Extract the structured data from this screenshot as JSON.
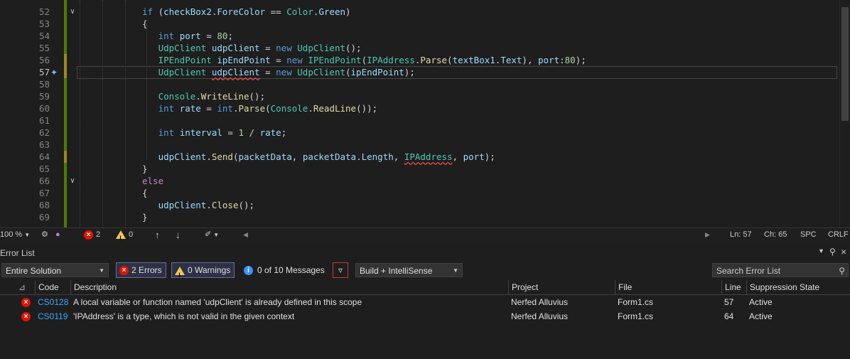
{
  "editor": {
    "lines": [
      {
        "num": "52",
        "tokens": [
          [
            "kw",
            "if"
          ],
          [
            "pl",
            " ("
          ],
          [
            "id",
            "checkBox2"
          ],
          [
            "pl",
            "."
          ],
          [
            "id",
            "ForeColor"
          ],
          [
            "pl",
            " == "
          ],
          [
            "ty",
            "Color"
          ],
          [
            "pl",
            "."
          ],
          [
            "id",
            "Green"
          ],
          [
            "pl",
            ")"
          ]
        ]
      },
      {
        "num": "53",
        "tokens": [
          [
            "pl",
            "{"
          ]
        ]
      },
      {
        "num": "54",
        "tokens": [
          [
            "pl",
            "   "
          ],
          [
            "kw",
            "int"
          ],
          [
            "pl",
            " "
          ],
          [
            "id",
            "port"
          ],
          [
            "pl",
            " = "
          ],
          [
            "num",
            "80"
          ],
          [
            "pl",
            ";"
          ]
        ]
      },
      {
        "num": "55",
        "tokens": [
          [
            "pl",
            "   "
          ],
          [
            "ty",
            "UdpClient"
          ],
          [
            "pl",
            " "
          ],
          [
            "id",
            "udpClient"
          ],
          [
            "pl",
            " = "
          ],
          [
            "kw",
            "new"
          ],
          [
            "pl",
            " "
          ],
          [
            "ty",
            "UdpClient"
          ],
          [
            "pl",
            "();"
          ]
        ]
      },
      {
        "num": "56",
        "tokens": [
          [
            "pl",
            "   "
          ],
          [
            "ty",
            "IPEndPoint"
          ],
          [
            "pl",
            " "
          ],
          [
            "id",
            "ipEndPoint"
          ],
          [
            "pl",
            " = "
          ],
          [
            "kw",
            "new"
          ],
          [
            "pl",
            " "
          ],
          [
            "ty",
            "IPEndPoint"
          ],
          [
            "pl",
            "("
          ],
          [
            "ty",
            "IPAddress"
          ],
          [
            "pl",
            "."
          ],
          [
            "fn",
            "Parse"
          ],
          [
            "pl",
            "("
          ],
          [
            "id",
            "textBox1"
          ],
          [
            "pl",
            "."
          ],
          [
            "id",
            "Text"
          ],
          [
            "pl",
            "), "
          ],
          [
            "param",
            "port"
          ],
          [
            "pl",
            ":"
          ],
          [
            "num",
            "80"
          ],
          [
            "pl",
            ");"
          ]
        ]
      },
      {
        "num": "57",
        "tokens": [
          [
            "pl",
            "   "
          ],
          [
            "ty",
            "UdpClient"
          ],
          [
            "pl",
            " "
          ],
          [
            "iderr",
            "udpClient"
          ],
          [
            "pl",
            " = "
          ],
          [
            "kw",
            "new"
          ],
          [
            "pl",
            " "
          ],
          [
            "ty",
            "UdpClient"
          ],
          [
            "pl",
            "("
          ],
          [
            "id",
            "ipEndPoint"
          ],
          [
            "pl",
            ");"
          ]
        ]
      },
      {
        "num": "58",
        "tokens": []
      },
      {
        "num": "59",
        "tokens": [
          [
            "pl",
            "   "
          ],
          [
            "ty",
            "Console"
          ],
          [
            "pl",
            "."
          ],
          [
            "fn",
            "WriteLine"
          ],
          [
            "pl",
            "();"
          ]
        ]
      },
      {
        "num": "60",
        "tokens": [
          [
            "pl",
            "   "
          ],
          [
            "kw",
            "int"
          ],
          [
            "pl",
            " "
          ],
          [
            "id",
            "rate"
          ],
          [
            "pl",
            " = "
          ],
          [
            "kw",
            "int"
          ],
          [
            "pl",
            "."
          ],
          [
            "fn",
            "Parse"
          ],
          [
            "pl",
            "("
          ],
          [
            "ty",
            "Console"
          ],
          [
            "pl",
            "."
          ],
          [
            "fn",
            "ReadLine"
          ],
          [
            "pl",
            "());"
          ]
        ]
      },
      {
        "num": "61",
        "tokens": []
      },
      {
        "num": "62",
        "tokens": [
          [
            "pl",
            "   "
          ],
          [
            "kw",
            "int"
          ],
          [
            "pl",
            " "
          ],
          [
            "id",
            "interval"
          ],
          [
            "pl",
            " = "
          ],
          [
            "num",
            "1"
          ],
          [
            "pl",
            " / "
          ],
          [
            "id",
            "rate"
          ],
          [
            "pl",
            ";"
          ]
        ]
      },
      {
        "num": "63",
        "tokens": []
      },
      {
        "num": "64",
        "tokens": [
          [
            "pl",
            "   "
          ],
          [
            "id",
            "udpClient"
          ],
          [
            "pl",
            "."
          ],
          [
            "fn",
            "Send"
          ],
          [
            "pl",
            "("
          ],
          [
            "id",
            "packetData"
          ],
          [
            "pl",
            ", "
          ],
          [
            "id",
            "packetData"
          ],
          [
            "pl",
            "."
          ],
          [
            "id",
            "Length"
          ],
          [
            "pl",
            ", "
          ],
          [
            "tyerr",
            "IPAddress"
          ],
          [
            "pl",
            ", "
          ],
          [
            "id",
            "port"
          ],
          [
            "pl",
            ");"
          ]
        ]
      },
      {
        "num": "65",
        "tokens": [
          [
            "pl",
            "}"
          ]
        ]
      },
      {
        "num": "66",
        "tokens": [
          [
            "ctl",
            "else"
          ]
        ]
      },
      {
        "num": "67",
        "tokens": [
          [
            "pl",
            "{"
          ]
        ]
      },
      {
        "num": "68",
        "tokens": [
          [
            "pl",
            "   "
          ],
          [
            "id",
            "udpClient"
          ],
          [
            "pl",
            "."
          ],
          [
            "fn",
            "Close"
          ],
          [
            "pl",
            "();"
          ]
        ]
      },
      {
        "num": "69",
        "tokens": [
          [
            "pl",
            "}"
          ]
        ]
      }
    ]
  },
  "statusbar": {
    "zoom": "100 %",
    "errors": "2",
    "warnings": "0",
    "ln": "Ln: 57",
    "ch": "Ch: 65",
    "spc": "SPC",
    "crlf": "CRLF"
  },
  "errorlist": {
    "title": "Error List",
    "scope": "Entire Solution",
    "errors_btn": "2 Errors",
    "warnings_btn": "0 Warnings",
    "messages_btn": "0 of 10 Messages",
    "build_filter": "Build + IntelliSense",
    "search_placeholder": "Search Error List",
    "columns": {
      "code": "Code",
      "description": "Description",
      "project": "Project",
      "file": "File",
      "line": "Line",
      "suppression": "Suppression State"
    },
    "rows": [
      {
        "code": "CS0128",
        "description": "A local variable or function named 'udpClient' is already defined in this scope",
        "project": "Nerfed Alluvius",
        "file": "Form1.cs",
        "line": "57",
        "state": "Active"
      },
      {
        "code": "CS0119",
        "description": "'IPAddress' is a type, which is not valid in the given context",
        "project": "Nerfed Alluvius",
        "file": "Form1.cs",
        "line": "64",
        "state": "Active"
      }
    ]
  },
  "colors": {
    "error": "#e51400",
    "warning": "#f2c94c",
    "info": "#3794ff",
    "accent": "#3ea6ff"
  }
}
